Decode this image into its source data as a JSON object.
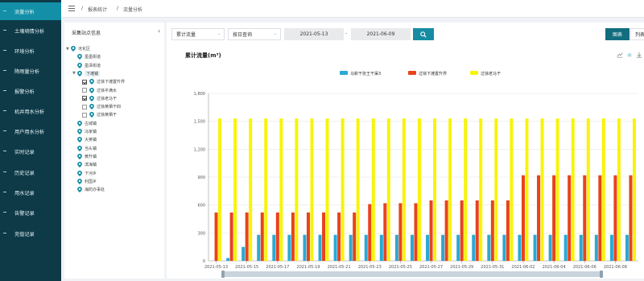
{
  "sidebar": {
    "items": [
      {
        "label": "流量分析",
        "active": true
      },
      {
        "label": "土壤墒情分析",
        "active": false
      },
      {
        "label": "环境分析",
        "active": false
      },
      {
        "label": "降雨量分析",
        "active": false
      },
      {
        "label": "报警分析",
        "active": false
      },
      {
        "label": "机井用水分析",
        "active": false
      },
      {
        "label": "用户用水分析",
        "active": false
      },
      {
        "label": "实时记录",
        "active": false
      },
      {
        "label": "历史记录",
        "active": false
      },
      {
        "label": "用水记录",
        "active": false
      },
      {
        "label": "告警记录",
        "active": false
      },
      {
        "label": "充值记录",
        "active": false
      }
    ]
  },
  "breadcrumb": {
    "sep": "/",
    "level1": "报表统计",
    "level2": "流量分析"
  },
  "tree": {
    "title": "采集站点信息",
    "nodes": [
      {
        "label": "沧化区",
        "depth": 0,
        "type": "pin",
        "arrow": "▼"
      },
      {
        "label": "墨墨街道",
        "depth": 1,
        "type": "pin"
      },
      {
        "label": "墨泽街道",
        "depth": 1,
        "type": "pin"
      },
      {
        "label": "下滩镇",
        "depth": 1,
        "type": "pin",
        "arrow": "▼",
        "selected": true
      },
      {
        "label": "过徐下滩置升界",
        "depth": 2,
        "type": "check",
        "checked": true
      },
      {
        "label": "过徐平满水",
        "depth": 2,
        "type": "check",
        "checked": false
      },
      {
        "label": "过徐老马干",
        "depth": 2,
        "type": "check",
        "checked": true
      },
      {
        "label": "过徐黄栖干四",
        "depth": 2,
        "type": "check",
        "checked": false
      },
      {
        "label": "过徐黄栖干",
        "depth": 2,
        "type": "check",
        "checked": false
      },
      {
        "label": "古城镇",
        "depth": 1,
        "type": "pin"
      },
      {
        "label": "冯家镇",
        "depth": 1,
        "type": "pin"
      },
      {
        "label": "大英镇",
        "depth": 1,
        "type": "pin"
      },
      {
        "label": "当头镇",
        "depth": 1,
        "type": "pin"
      },
      {
        "label": "黄升镇",
        "depth": 1,
        "type": "pin"
      },
      {
        "label": "滨海镇",
        "depth": 1,
        "type": "pin"
      },
      {
        "label": "下河乡",
        "depth": 1,
        "type": "pin"
      },
      {
        "label": "利国乡",
        "depth": 1,
        "type": "pin"
      },
      {
        "label": "海防办事处",
        "depth": 1,
        "type": "pin"
      }
    ]
  },
  "filters": {
    "type_select": "累计流量",
    "query_select": "按日查询",
    "date_start": "2021-05-13",
    "date_sep": "-",
    "date_end": "2021-06-09",
    "view_chart": "图表",
    "view_list": "列表"
  },
  "chart_title": "累计流量(m³)",
  "colors": {
    "sidebar_bg": "#0e3a48",
    "sidebar_active": "#1390a7",
    "accent": "#168ca2",
    "series1": "#2aa9d2",
    "series2": "#e8431c",
    "series3": "#f7f40b"
  },
  "chart_data": {
    "type": "bar",
    "title": "累计流量(m³)",
    "ylim": [
      0,
      1800
    ],
    "yticks": [
      "0",
      "300",
      "600",
      "900",
      "1,200",
      "1,500",
      "1,800"
    ],
    "grid": true,
    "legend_position": "top-center",
    "categories": [
      "2021-05-13",
      "2021-05-14",
      "2021-05-15",
      "2021-05-16",
      "2021-05-17",
      "2021-05-18",
      "2021-05-19",
      "2021-05-20",
      "2021-05-21",
      "2021-05-22",
      "2021-05-23",
      "2021-05-24",
      "2021-05-25",
      "2021-05-26",
      "2021-05-27",
      "2021-05-28",
      "2021-05-29",
      "2021-05-30",
      "2021-05-31",
      "2021-06-01",
      "2021-06-02",
      "2021-06-03",
      "2021-06-04",
      "2021-06-05",
      "2021-06-06",
      "2021-06-07",
      "2021-06-08",
      "2021-06-09"
    ],
    "xticks": [
      "2021-05-13",
      "2021-05-15",
      "2021-05-17",
      "2021-05-19",
      "2021-05-21",
      "2021-05-23",
      "2021-05-25",
      "2021-05-27",
      "2021-05-29",
      "2021-05-31",
      "2021-06-02",
      "2021-06-04",
      "2021-06-06",
      "2021-06-08"
    ],
    "series": [
      {
        "name": "马新干张王干渠3",
        "values": [
          0,
          30,
          150,
          280,
          280,
          280,
          280,
          280,
          280,
          280,
          280,
          280,
          280,
          280,
          280,
          280,
          280,
          280,
          280,
          280,
          280,
          280,
          280,
          280,
          280,
          280,
          280,
          280
        ]
      },
      {
        "name": "过徐下滩置升界",
        "values": [
          520,
          520,
          520,
          520,
          520,
          520,
          520,
          520,
          520,
          520,
          610,
          620,
          620,
          620,
          650,
          650,
          650,
          650,
          650,
          650,
          920,
          920,
          920,
          920,
          920,
          920,
          920,
          920
        ]
      },
      {
        "name": "过徐老马干",
        "values": [
          1530,
          1530,
          1530,
          1530,
          1530,
          1530,
          1530,
          1530,
          1530,
          1530,
          1530,
          1530,
          1530,
          1530,
          1530,
          1530,
          1530,
          1530,
          1530,
          1530,
          1530,
          1530,
          1530,
          1530,
          1530,
          1530,
          1530,
          1530
        ]
      }
    ]
  }
}
